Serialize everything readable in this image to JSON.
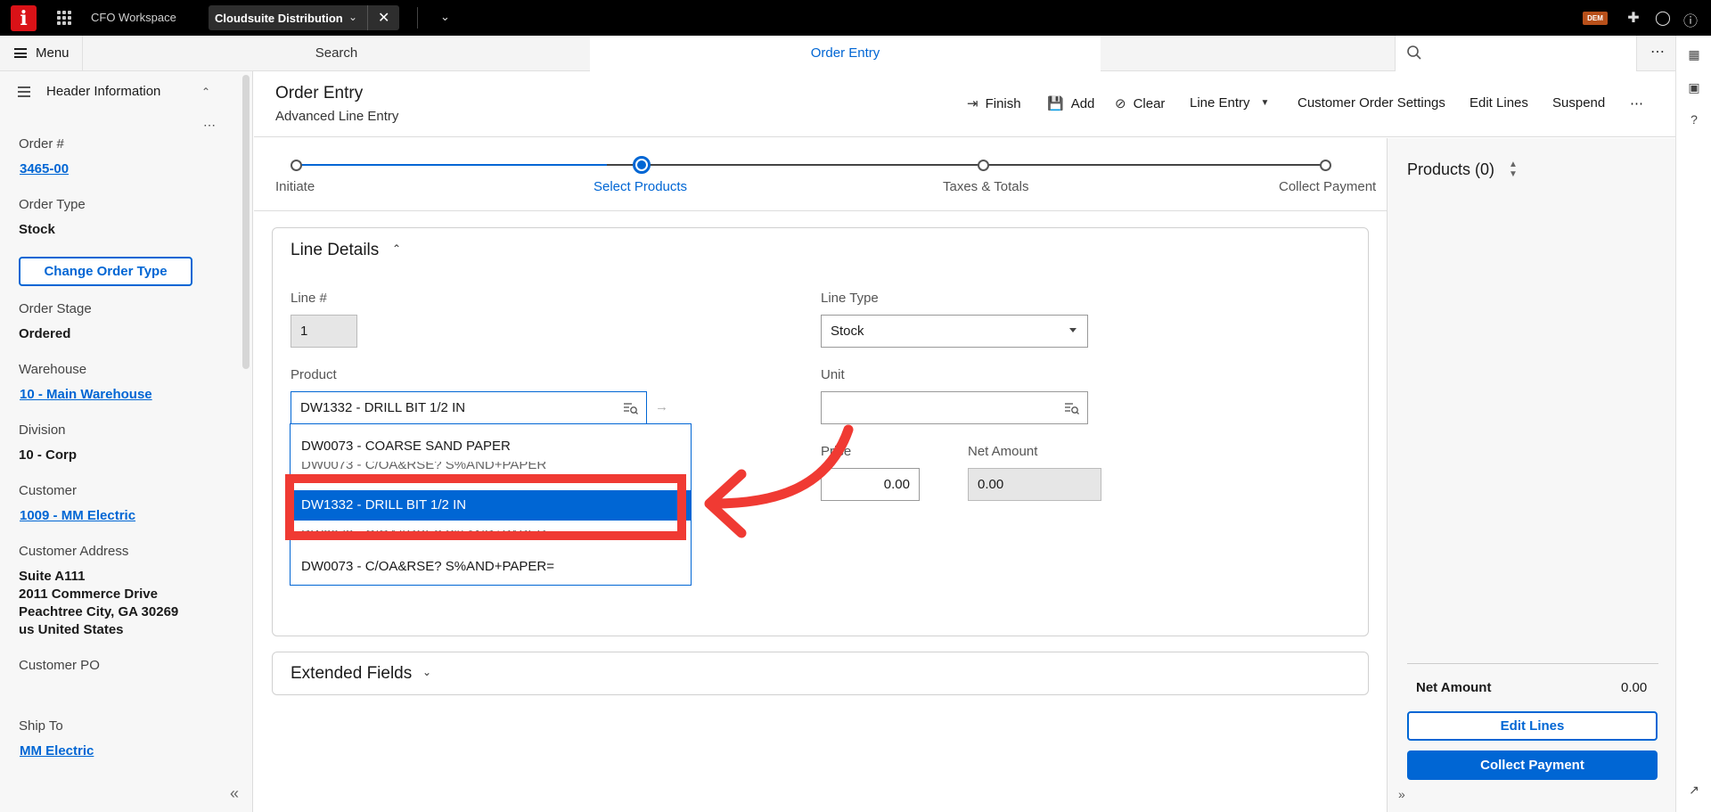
{
  "topbar": {
    "logo": "i",
    "workspace": "CFO Workspace",
    "tab_label": "Cloudsuite Distribution",
    "badge": "DEM"
  },
  "nav": {
    "menu_label": "Menu",
    "search_tab": "Search",
    "active_tab": "Order Entry"
  },
  "left_panel": {
    "title": "Header Information",
    "fields": {
      "order_label": "Order #",
      "order_value": "3465-00",
      "order_type_label": "Order Type",
      "order_type_value": "Stock",
      "change_btn": "Change Order Type",
      "order_stage_label": "Order Stage",
      "order_stage_value": "Ordered",
      "warehouse_label": "Warehouse",
      "warehouse_value": "10 - Main Warehouse",
      "division_label": "Division",
      "division_value": "10 - Corp",
      "customer_label": "Customer",
      "customer_value": "1009 - MM Electric",
      "address_label": "Customer Address",
      "address_line1": "Suite A111",
      "address_line2": "2011 Commerce Drive",
      "address_line3": "Peachtree City, GA 30269",
      "address_line4": "us United States",
      "po_label": "Customer PO",
      "shipto_label": "Ship To",
      "shipto_value": "MM Electric"
    }
  },
  "header": {
    "title": "Order Entry",
    "subtitle": "Advanced Line Entry",
    "toolbar": {
      "finish": "Finish",
      "add": "Add",
      "clear": "Clear",
      "line_entry": "Line Entry",
      "customer_settings": "Customer Order Settings",
      "edit_lines": "Edit Lines",
      "suspend": "Suspend"
    }
  },
  "stepper": {
    "steps": [
      "Initiate",
      "Select Products",
      "Taxes & Totals",
      "Collect Payment"
    ],
    "active_index": 1
  },
  "line_details": {
    "title": "Line Details",
    "line_no_label": "Line #",
    "line_no_value": "1",
    "line_type_label": "Line Type",
    "line_type_value": "Stock",
    "product_label": "Product",
    "product_value": "DW1332 - DRILL BIT 1/2 IN",
    "unit_label": "Unit",
    "unit_value": "",
    "price_label": "Price",
    "price_value": "0.00",
    "net_amount_label": "Net Amount",
    "net_amount_value": "0.00",
    "dropdown": [
      "DW0073 - COARSE SAND PAPER",
      "DW0073 - C/OA&RSE? S%AND+PAPER",
      "DW1332 - DRILL BIT 1/2 IN",
      "DW0073 - C/OA&RSE? S%AND+PAPER",
      "DW0073 - C/OA&RSE? S%AND+PAPER="
    ],
    "selected_index": 2
  },
  "extended": {
    "title": "Extended Fields"
  },
  "products_panel": {
    "title": "Products (0)",
    "net_amount_label": "Net Amount",
    "net_amount_value": "0.00",
    "edit_lines": "Edit Lines",
    "collect_payment": "Collect Payment"
  },
  "colors": {
    "accent": "#0066d4",
    "annotation": "#f03a33",
    "logo": "#da1217"
  }
}
